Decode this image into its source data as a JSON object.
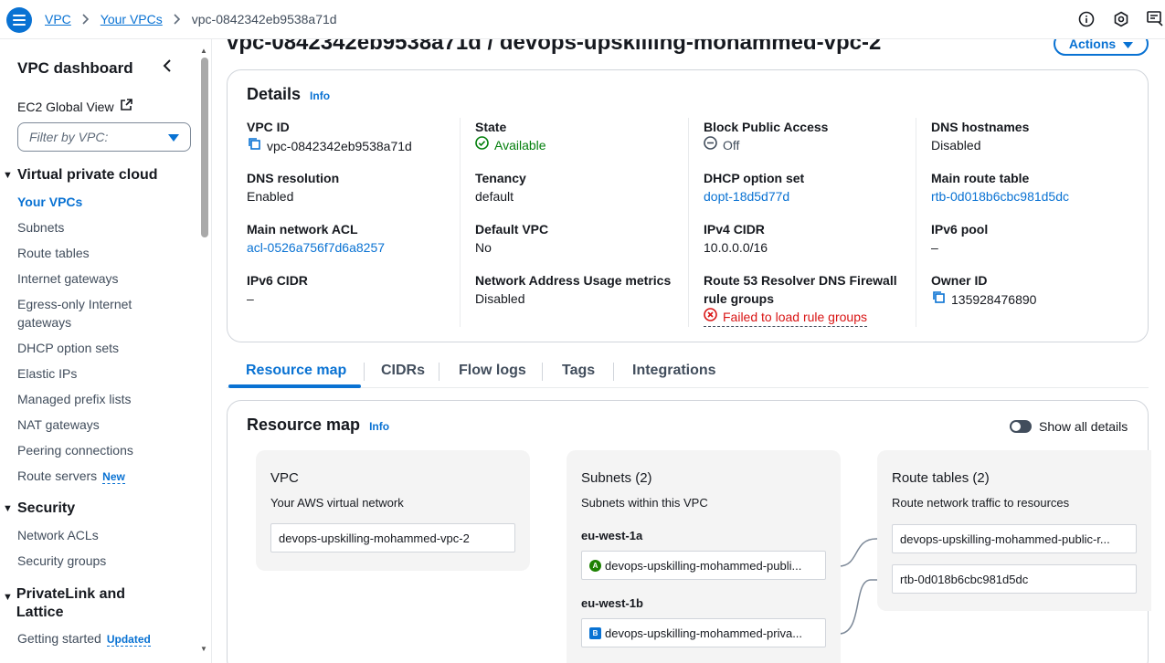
{
  "breadcrumb": {
    "items": [
      "VPC",
      "Your VPCs"
    ],
    "current": "vpc-0842342eb9538a71d"
  },
  "sidebar": {
    "title": "VPC dashboard",
    "ec2_global_view": "EC2 Global View",
    "filter_placeholder": "Filter by VPC:",
    "sections": [
      {
        "title": "Virtual private cloud"
      },
      {
        "title": "Security"
      },
      {
        "title": "PrivateLink and Lattice"
      }
    ],
    "vpc_items": [
      "Your VPCs",
      "Subnets",
      "Route tables",
      "Internet gateways",
      "Egress-only Internet gateways",
      "DHCP option sets",
      "Elastic IPs",
      "Managed prefix lists",
      "NAT gateways",
      "Peering connections",
      "Route servers"
    ],
    "new_badge": "New",
    "security_items": [
      "Network ACLs",
      "Security groups"
    ],
    "privatelink_items": [
      "Getting started"
    ],
    "updated_badge": "Updated"
  },
  "page": {
    "title": "vpc-0842342eb9538a71d / devops-upskilling-mohammed-vpc-2",
    "actions_label": "Actions"
  },
  "details": {
    "heading": "Details",
    "info": "Info",
    "fields": {
      "vpc_id": {
        "label": "VPC ID",
        "value": "vpc-0842342eb9538a71d"
      },
      "state": {
        "label": "State",
        "value": "Available"
      },
      "block_public_access": {
        "label": "Block Public Access",
        "value": "Off"
      },
      "dns_hostnames": {
        "label": "DNS hostnames",
        "value": "Disabled"
      },
      "dns_resolution": {
        "label": "DNS resolution",
        "value": "Enabled"
      },
      "tenancy": {
        "label": "Tenancy",
        "value": "default"
      },
      "dhcp_option_set": {
        "label": "DHCP option set",
        "value": "dopt-18d5d77d"
      },
      "main_route_table": {
        "label": "Main route table",
        "value": "rtb-0d018b6cbc981d5dc"
      },
      "main_network_acl": {
        "label": "Main network ACL",
        "value": "acl-0526a756f7d6a8257"
      },
      "default_vpc": {
        "label": "Default VPC",
        "value": "No"
      },
      "ipv4_cidr": {
        "label": "IPv4 CIDR",
        "value": "10.0.0.0/16"
      },
      "ipv6_pool": {
        "label": "IPv6 pool",
        "value": "–"
      },
      "ipv6_cidr": {
        "label": "IPv6 CIDR",
        "value": "–"
      },
      "network_address_usage": {
        "label": "Network Address Usage metrics",
        "value": "Disabled"
      },
      "route53_resolver": {
        "label_line1": "Route 53 Resolver DNS Firewall",
        "label_line2": "rule groups",
        "value": "Failed to load rule groups"
      },
      "owner_id": {
        "label": "Owner ID",
        "value": "135928476890"
      }
    }
  },
  "tabs": [
    "Resource map",
    "CIDRs",
    "Flow logs",
    "Tags",
    "Integrations"
  ],
  "resource_map": {
    "heading": "Resource map",
    "info": "Info",
    "toggle_label": "Show all details",
    "vpc": {
      "title": "VPC",
      "subtitle": "Your AWS virtual network",
      "item": "devops-upskilling-mohammed-vpc-2"
    },
    "subnets": {
      "title": "Subnets (2)",
      "subtitle": "Subnets within this VPC",
      "groups": [
        {
          "az": "eu-west-1a",
          "badge": "A",
          "item": "devops-upskilling-mohammed-publi..."
        },
        {
          "az": "eu-west-1b",
          "badge": "B",
          "item": "devops-upskilling-mohammed-priva..."
        }
      ]
    },
    "route_tables": {
      "title": "Route tables (2)",
      "subtitle": "Route network traffic to resources",
      "items": [
        "devops-upskilling-mohammed-public-r...",
        "rtb-0d018b6cbc981d5dc"
      ]
    }
  }
}
